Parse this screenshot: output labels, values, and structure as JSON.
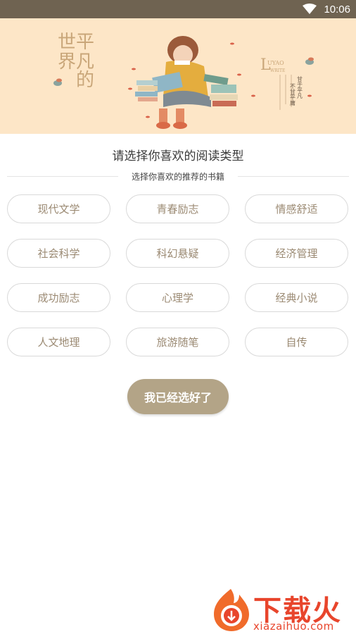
{
  "status_bar": {
    "time": "10:06"
  },
  "banner": {
    "art_text_left": [
      "世平",
      "界凡",
      "的"
    ],
    "art_text_right": [
      "甘于平凡",
      "不甘平庸"
    ]
  },
  "header": {
    "title": "请选择你喜欢的阅读类型",
    "subtitle": "选择你喜欢的推荐的书籍"
  },
  "genres": [
    "现代文学",
    "青春励志",
    "情感舒适",
    "社会科学",
    "科幻悬疑",
    "经济管理",
    "成功励志",
    "心理学",
    "经典小说",
    "人文地理",
    "旅游随笔",
    "自传"
  ],
  "confirm_label": "我已经选好了",
  "watermark": {
    "brand": "下载火",
    "domain": "xiazaihuo.com"
  },
  "colors": {
    "accent": "#b3a487",
    "status_bar": "#6f6351",
    "banner_bg": "#fde6c7",
    "genre_text": "#9b8a73"
  }
}
